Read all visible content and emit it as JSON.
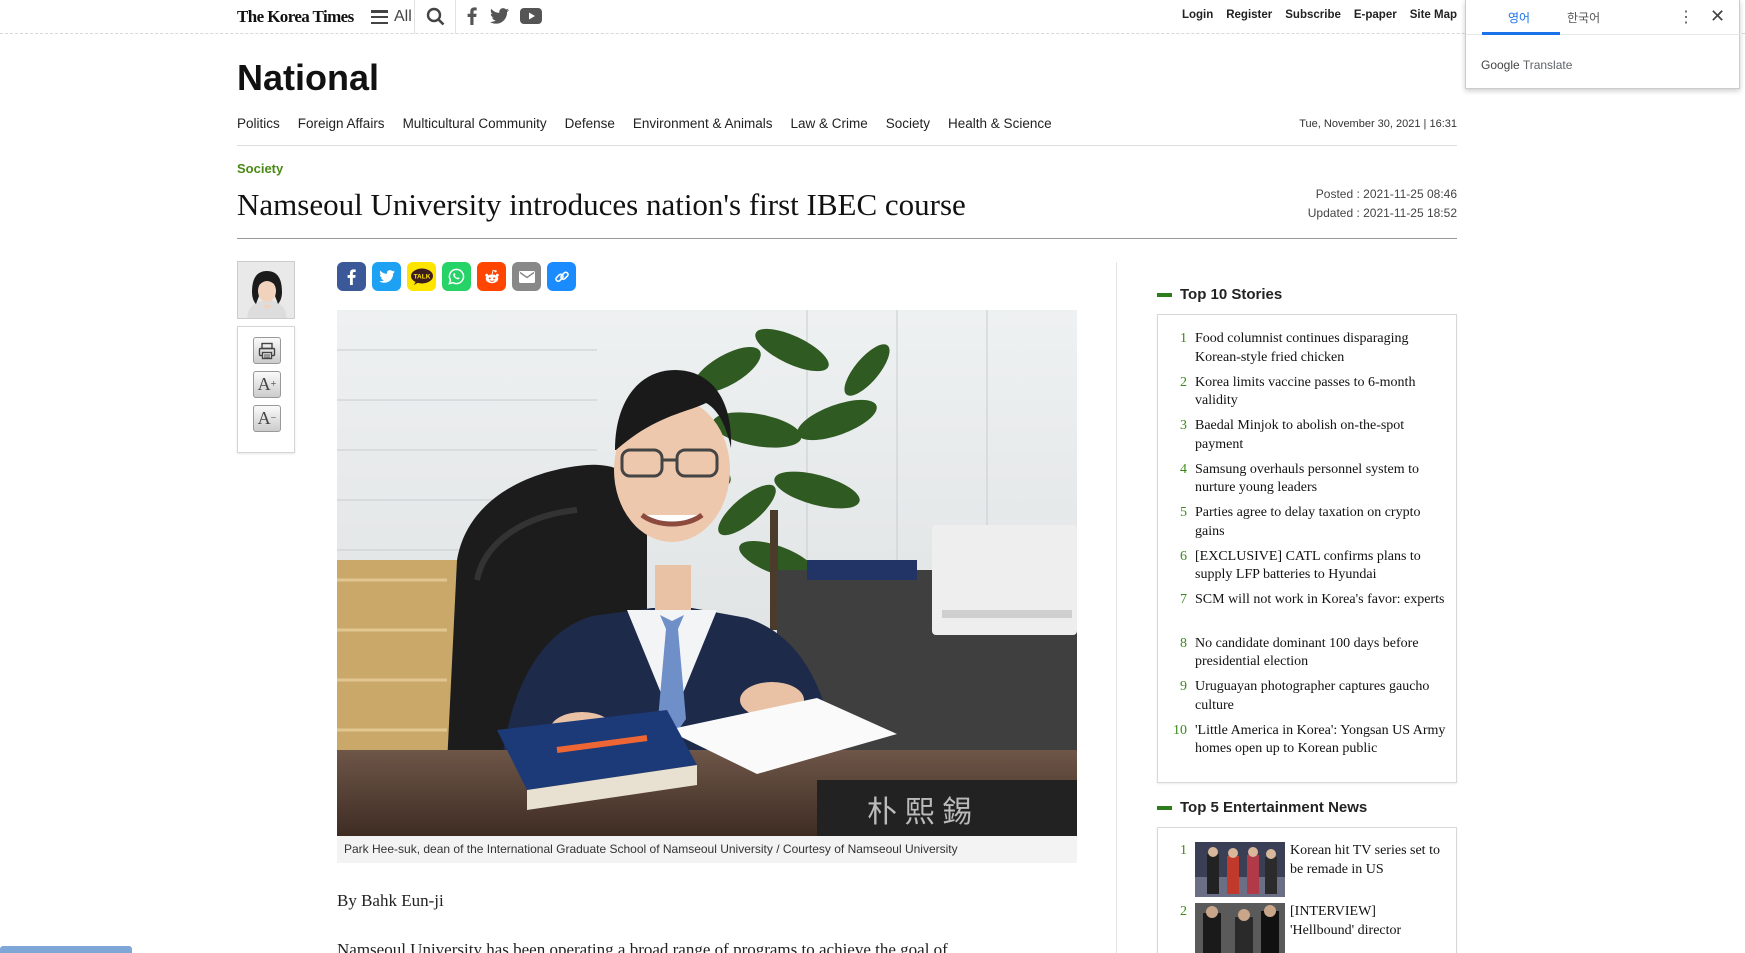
{
  "topbar": {
    "logo": "The Korea Times",
    "all_label": "All",
    "links": [
      "Login",
      "Register",
      "Subscribe",
      "E-paper",
      "Site Map"
    ]
  },
  "translate_popup": {
    "tab_english": "영어",
    "tab_korean": "한국어",
    "brand_google": "Google",
    "brand_translate": "Translate"
  },
  "section": {
    "title": "National",
    "nav": [
      "Politics",
      "Foreign Affairs",
      "Multicultural Community",
      "Defense",
      "Environment & Animals",
      "Law & Crime",
      "Society",
      "Health & Science"
    ],
    "date": "Tue, November 30, 2021 | 16:31"
  },
  "article": {
    "category": "Society",
    "headline": "Namseoul University introduces nation's first IBEC course",
    "posted": "Posted : 2021-11-25 08:46",
    "updated": "Updated : 2021-11-25 18:52",
    "caption": "Park Hee-suk, dean of the International Graduate School of Namseoul University / Courtesy of Namseoul University",
    "byline": "By Bahk Eun-ji",
    "body_first_line": "Namseoul University has been operating a broad range of programs to achieve the goal of"
  },
  "share": {
    "kakao_label": "TALK"
  },
  "sidebar": {
    "top10_title": "Top 10 Stories",
    "top10": [
      {
        "num": "1",
        "title": "Food columnist continues disparaging Korean-style fried chicken"
      },
      {
        "num": "2",
        "title": "Korea limits vaccine passes to 6-month validity"
      },
      {
        "num": "3",
        "title": "Baedal Minjok to abolish on-the-spot payment"
      },
      {
        "num": "4",
        "title": "Samsung overhauls personnel system to nurture young leaders"
      },
      {
        "num": "5",
        "title": "Parties agree to delay taxation on crypto gains"
      },
      {
        "num": "6",
        "title": "[EXCLUSIVE] CATL confirms plans to supply LFP batteries to Hyundai"
      },
      {
        "num": "7",
        "title": "SCM will not work in Korea's favor: experts"
      },
      {
        "num": "8",
        "title": "No candidate dominant 100 days before presidential election"
      },
      {
        "num": "9",
        "title": "Uruguayan photographer captures gaucho culture"
      },
      {
        "num": "10",
        "title": "'Little America in Korea': Yongsan US Army homes open up to Korean public"
      }
    ],
    "ent_title": "Top 5 Entertainment News",
    "ent": [
      {
        "num": "1",
        "title": "Korean hit TV series set to be remade in US"
      },
      {
        "num": "2",
        "title": "[INTERVIEW] 'Hellbound' director"
      }
    ]
  },
  "colors": {
    "accent_green": "#3a8a1a",
    "facebook": "#3b5998",
    "twitter": "#1da1f2",
    "kakao": "#fee500",
    "whatsapp": "#25d366",
    "reddit": "#ff4500",
    "email": "#888888",
    "link": "#1a8cff",
    "translate_blue": "#1a73e8"
  }
}
